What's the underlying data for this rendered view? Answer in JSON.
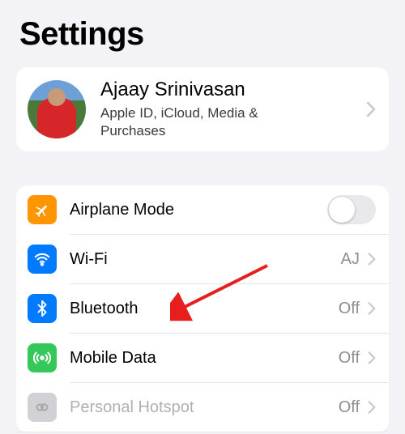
{
  "title": "Settings",
  "profile": {
    "name": "Ajaay Srinivasan",
    "subtitle": "Apple ID, iCloud, Media & Purchases"
  },
  "rows": {
    "airplane": {
      "label": "Airplane Mode",
      "toggle": false
    },
    "wifi": {
      "label": "Wi-Fi",
      "value": "AJ"
    },
    "bluetooth": {
      "label": "Bluetooth",
      "value": "Off"
    },
    "mobiledata": {
      "label": "Mobile Data",
      "value": "Off"
    },
    "hotspot": {
      "label": "Personal Hotspot",
      "value": "Off"
    }
  }
}
